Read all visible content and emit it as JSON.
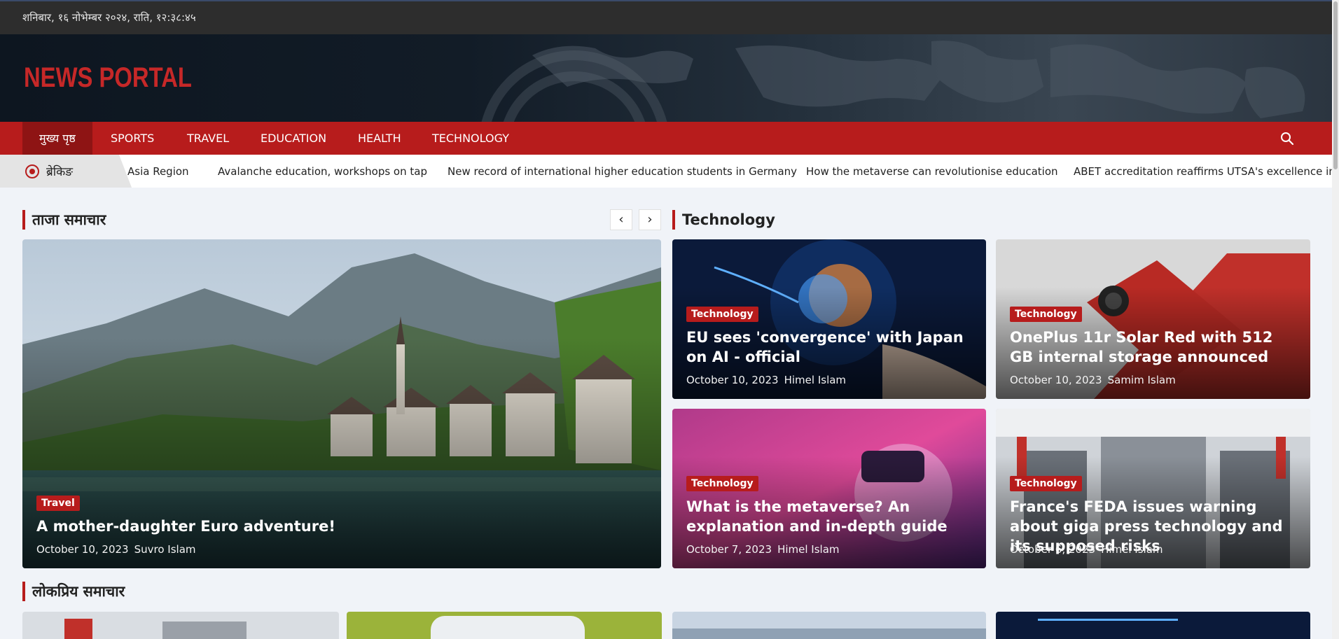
{
  "topbar": {
    "date": "शनिबार, १६ नोभेम्बर २०२४, राति, १२:३८:४५"
  },
  "header": {
    "logo": "NEWS PORTAL"
  },
  "nav": {
    "items": [
      "मुख्य पृष्ठ",
      "SPORTS",
      "TRAVEL",
      "EDUCATION",
      "HEALTH",
      "TECHNOLOGY"
    ],
    "search_icon": "search-icon"
  },
  "ticker": {
    "label": "ब्रेकिङ",
    "items": [
      "Asia Region",
      "Avalanche education, workshops on tap",
      "New record of international higher education students in Germany",
      "How the metaverse can revolutionise education",
      "ABET accreditation reaffirms UTSA's excellence in eng"
    ]
  },
  "latest": {
    "title": "ताजा समाचार",
    "prev": "‹",
    "next": "›",
    "featured": {
      "category": "Travel",
      "title": "A mother-daughter Euro adventure!",
      "date": "October 10, 2023",
      "author": "Suvro Islam"
    }
  },
  "technology": {
    "title": "Technology",
    "cards": [
      {
        "category": "Technology",
        "title": "EU sees 'convergence' with Japan on AI - official",
        "date": "October 10, 2023",
        "author": "Himel Islam"
      },
      {
        "category": "Technology",
        "title": "OnePlus 11r Solar Red with 512 GB internal storage announced",
        "date": "October 10, 2023",
        "author": "Samim Islam"
      },
      {
        "category": "Technology",
        "title": "What is the metaverse? An explanation and in-depth guide",
        "date": "October 7, 2023",
        "author": "Himel Islam"
      },
      {
        "category": "Technology",
        "title": "France's FEDA issues warning about giga press technology and its supposed risks",
        "date": "October 6, 2023",
        "author": "Himel Islam"
      }
    ]
  },
  "popular": {
    "title": "लोकप्रिय समाचार"
  },
  "colors": {
    "accent": "#b71c1c",
    "topbar": "#2d2d2d",
    "page_bg": "#f0f3f8"
  }
}
